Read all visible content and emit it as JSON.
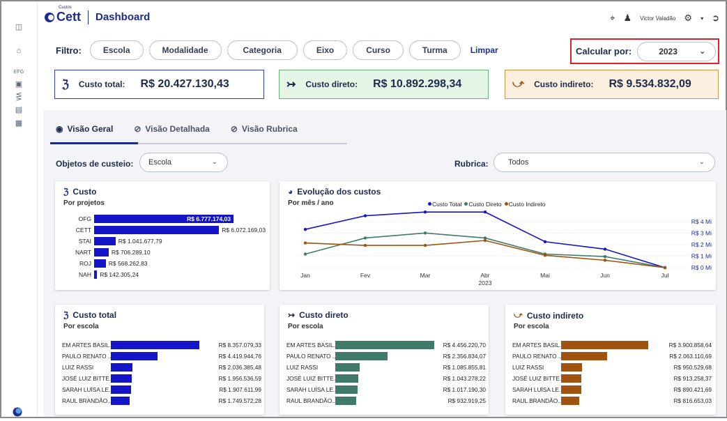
{
  "app": {
    "logo_sup": "Custos",
    "logo": "Cett",
    "title": "Dashboard"
  },
  "user": {
    "name": "Victor Valadão"
  },
  "sidebar": {
    "items": [
      {
        "label": "EFG"
      }
    ]
  },
  "filters": {
    "label": "Filtro:",
    "pills": [
      "Escola",
      "Modalidade",
      "Categoria",
      "Eixo",
      "Curso",
      "Turma"
    ],
    "clear": "Limpar"
  },
  "calc": {
    "label": "Calcular por:",
    "value": "2023"
  },
  "kpis": [
    {
      "label": "Custo total:",
      "value": "R$ 20.427.130,43"
    },
    {
      "label": "Custo direto:",
      "value": "R$ 10.892.298,34"
    },
    {
      "label": "Custo indireto:",
      "value": "R$ 9.534.832,09"
    }
  ],
  "tabs": [
    "Visão Geral",
    "Visão Detalhada",
    "Visão Rubrica"
  ],
  "objetos": {
    "label": "Objetos de custeio:",
    "value": "Escola"
  },
  "rubrica": {
    "label": "Rubrica:",
    "value": "Todos"
  },
  "colors": {
    "total": "#1515c8",
    "direto": "#3f7a6b",
    "indireto": "#a0530e"
  },
  "custo_card": {
    "title": "Custo",
    "subtitle": "Por projetos"
  },
  "evolucao_card": {
    "title": "Evolução dos custos",
    "subtitle": "Por mês / ano"
  },
  "total_card": {
    "title": "Custo total",
    "subtitle": "Por escola"
  },
  "direto_card": {
    "title": "Custo direto",
    "subtitle": "Por escola"
  },
  "indireto_card": {
    "title": "Custo indireto",
    "subtitle": "Por escola"
  },
  "chart_data": [
    {
      "type": "bar",
      "title": "Custo",
      "subtitle": "Por projetos",
      "orientation": "horizontal",
      "categories": [
        "OFG",
        "CETT",
        "STAI",
        "NART",
        "ROJ",
        "NAH"
      ],
      "values": [
        6777174.03,
        6072169.03,
        1041677.79,
        706289.1,
        568262.83,
        142305.24
      ],
      "labels": [
        "R$ 6.777.174,03",
        "R$ 6.072.169,03",
        "R$ 1.041.677,79",
        "R$ 706.289,10",
        "R$ 568.262,83",
        "R$ 142.305,24"
      ]
    },
    {
      "type": "line",
      "title": "Evolução dos custos",
      "subtitle": "Por mês / ano",
      "x": [
        "Jan",
        "Fev",
        "Mar",
        "Abr",
        "Mai",
        "Jun",
        "Jul"
      ],
      "x_sub": "2023",
      "y_ticks": [
        "R$ 0 Mi",
        "R$ 1 Mi",
        "R$ 2 Mi",
        "R$ 3 Mi",
        "R$ 4 Mi"
      ],
      "ylim": [
        0,
        4.4
      ],
      "series": [
        {
          "name": "Custo Total",
          "values": [
            3.1,
            4.2,
            4.5,
            4.5,
            2.1,
            1.5,
            0
          ]
        },
        {
          "name": "Custo Direto",
          "values": [
            1.1,
            2.4,
            2.8,
            2.4,
            1.1,
            0.9,
            0
          ]
        },
        {
          "name": "Custo Indireto",
          "values": [
            2.0,
            1.8,
            1.8,
            2.2,
            1.0,
            0.6,
            0
          ]
        }
      ]
    },
    {
      "type": "bar",
      "title": "Custo total",
      "subtitle": "Por escola",
      "orientation": "horizontal",
      "categories": [
        "EM ARTES BASIL...",
        "PAULO RENATO ...",
        "LUIZ RASSI",
        "JOSÉ LUIZ BITTE...",
        "SARAH LUÍSA LE...",
        "RAUL BRANDÃO..."
      ],
      "values": [
        8357079.33,
        4419944.76,
        2036385.48,
        1956536.59,
        1907611.99,
        1749572.28
      ],
      "labels": [
        "R$ 8.357.079,33",
        "R$ 4.419.944,76",
        "R$ 2.036.385,48",
        "R$ 1.956.536,59",
        "R$ 1.907.611,99",
        "R$ 1.749.572,28"
      ]
    },
    {
      "type": "bar",
      "title": "Custo direto",
      "subtitle": "Por escola",
      "orientation": "horizontal",
      "categories": [
        "EM ARTES BASIL...",
        "PAULO RENATO ...",
        "LUIZ RASSI",
        "JOSÉ LUIZ BITTE...",
        "SARAH LUÍSA LE...",
        "RAUL BRANDÃO..."
      ],
      "values": [
        4456220.7,
        2356834.07,
        1085855.81,
        1043278.22,
        1017190.3,
        932919.25
      ],
      "labels": [
        "R$ 4.456.220,70",
        "R$ 2.356.834,07",
        "R$ 1.085.855,81",
        "R$ 1.043.278,22",
        "R$ 1.017.190,30",
        "R$ 932.919,25"
      ]
    },
    {
      "type": "bar",
      "title": "Custo indireto",
      "subtitle": "Por escola",
      "orientation": "horizontal",
      "categories": [
        "EM ARTES BASIL...",
        "PAULO RENATO ...",
        "LUIZ RASSI",
        "JOSÉ LUIZ BITTE...",
        "SARAH LUÍSA LE...",
        "RAUL BRANDÃO..."
      ],
      "values": [
        3900858.64,
        2063110.69,
        950529.68,
        913258.37,
        890421.69,
        816653.03
      ],
      "labels": [
        "R$ 3.900.858,64",
        "R$ 2.063.110,69",
        "R$ 950.529,68",
        "R$ 913.258,37",
        "R$ 890.421,69",
        "R$ 816.653,03"
      ]
    }
  ]
}
